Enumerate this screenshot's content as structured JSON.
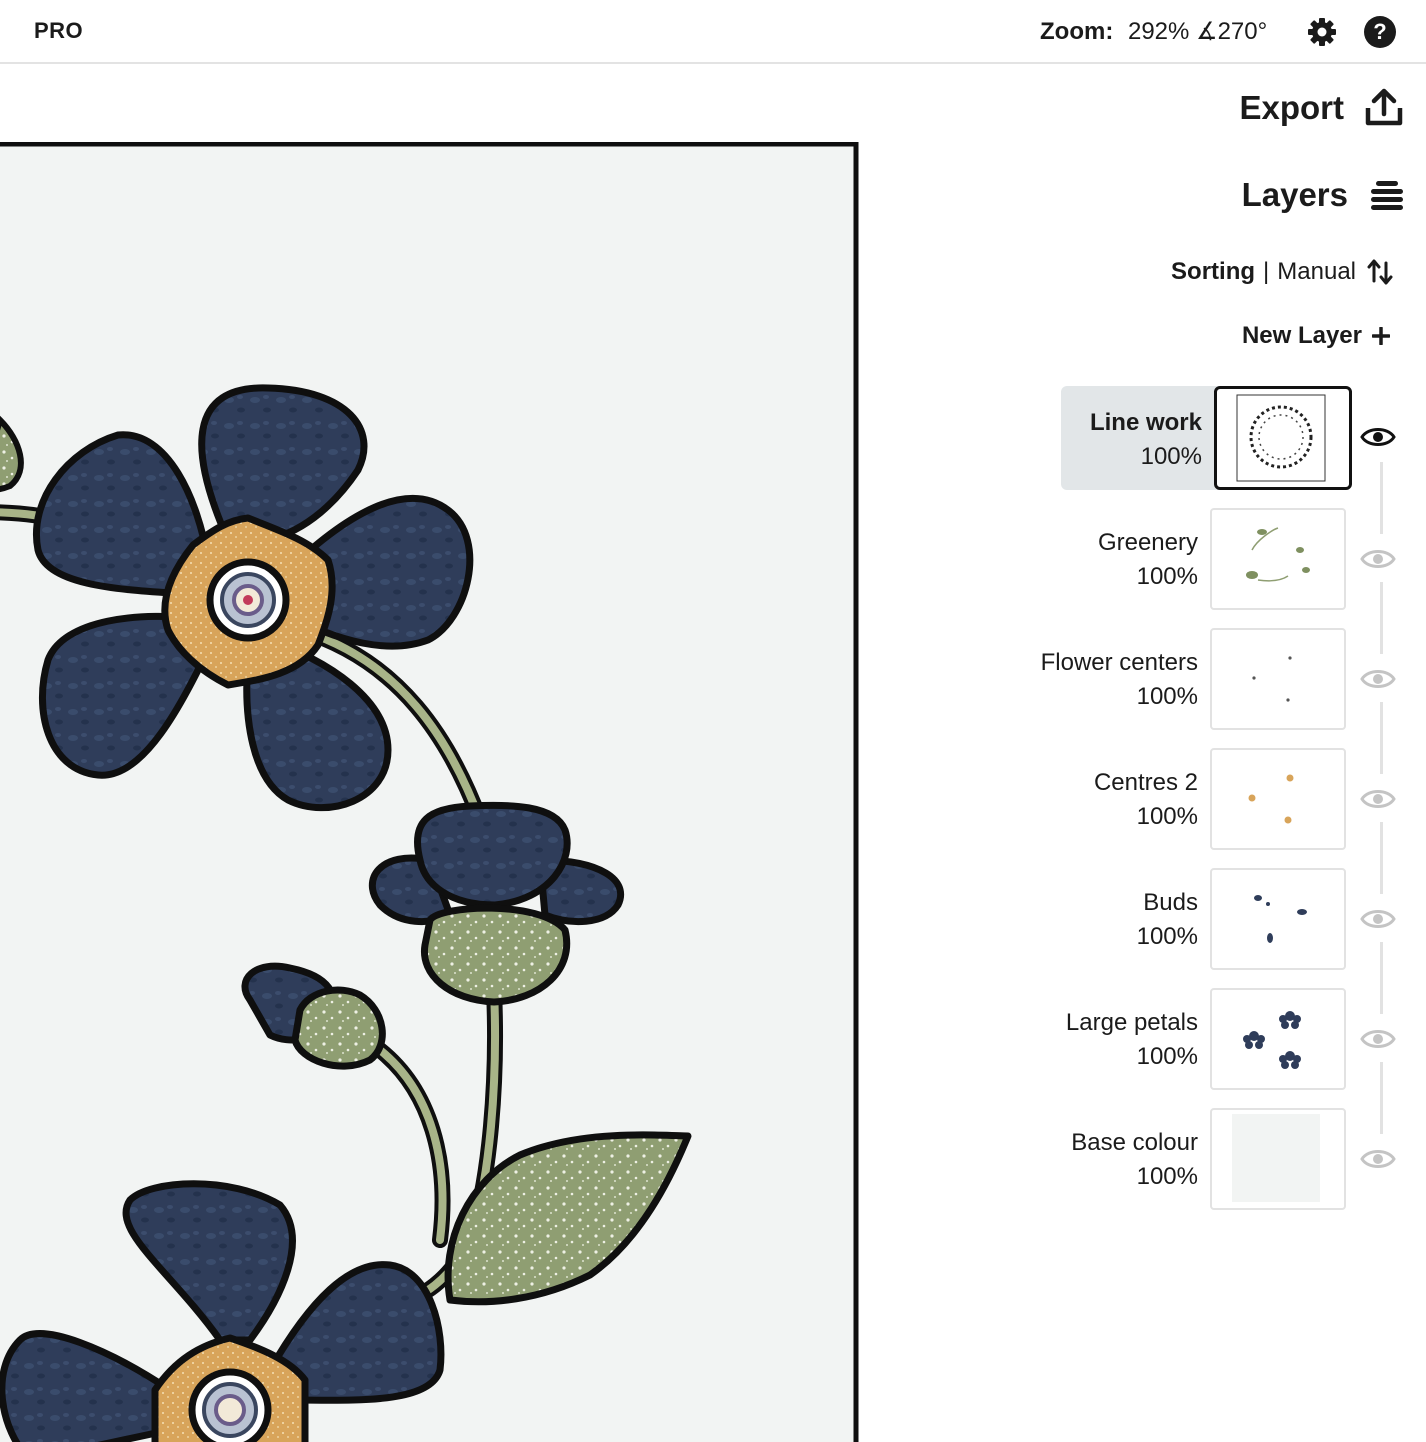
{
  "app": {
    "badge": "PRO"
  },
  "topbar": {
    "zoom_label": "Zoom:",
    "zoom_value": "292%",
    "rotation": "∡270°"
  },
  "panel": {
    "export_label": "Export",
    "layers_label": "Layers",
    "sorting_label": "Sorting",
    "sorting_separator": "|",
    "sorting_value": "Manual",
    "new_layer_label": "New Layer"
  },
  "layers": [
    {
      "name": "Line work",
      "opacity": "100%",
      "selected": true,
      "visible": true
    },
    {
      "name": "Greenery",
      "opacity": "100%",
      "selected": false,
      "visible": true
    },
    {
      "name": "Flower centers",
      "opacity": "100%",
      "selected": false,
      "visible": true
    },
    {
      "name": "Centres 2",
      "opacity": "100%",
      "selected": false,
      "visible": true
    },
    {
      "name": "Buds",
      "opacity": "100%",
      "selected": false,
      "visible": true
    },
    {
      "name": "Large petals",
      "opacity": "100%",
      "selected": false,
      "visible": true
    },
    {
      "name": "Base colour",
      "opacity": "100%",
      "selected": false,
      "visible": true
    }
  ],
  "colors": {
    "petal": "#2f3d5a",
    "petal_dark": "#243049",
    "green": "#8f9e72",
    "gold": "#d8a45a",
    "artboard_bg": "#f2f4f3",
    "outline": "#0f0f0f",
    "selected_bg": "#e2e6e8"
  }
}
